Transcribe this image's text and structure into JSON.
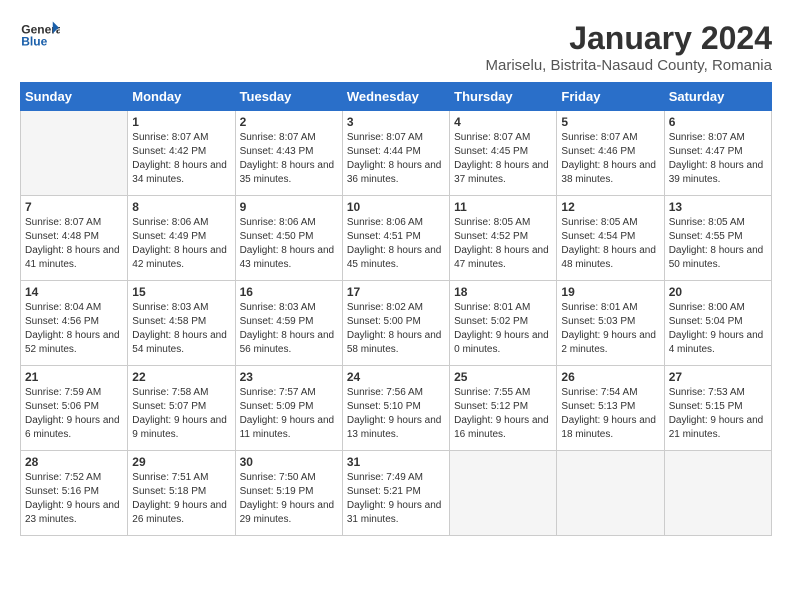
{
  "header": {
    "logo_general": "General",
    "logo_blue": "Blue",
    "title": "January 2024",
    "subtitle": "Mariselu, Bistrita-Nasaud County, Romania"
  },
  "days_of_week": [
    "Sunday",
    "Monday",
    "Tuesday",
    "Wednesday",
    "Thursday",
    "Friday",
    "Saturday"
  ],
  "weeks": [
    [
      {
        "day": "",
        "sunrise": "",
        "sunset": "",
        "daylight": "",
        "empty": true
      },
      {
        "day": "1",
        "sunrise": "Sunrise: 8:07 AM",
        "sunset": "Sunset: 4:42 PM",
        "daylight": "Daylight: 8 hours and 34 minutes."
      },
      {
        "day": "2",
        "sunrise": "Sunrise: 8:07 AM",
        "sunset": "Sunset: 4:43 PM",
        "daylight": "Daylight: 8 hours and 35 minutes."
      },
      {
        "day": "3",
        "sunrise": "Sunrise: 8:07 AM",
        "sunset": "Sunset: 4:44 PM",
        "daylight": "Daylight: 8 hours and 36 minutes."
      },
      {
        "day": "4",
        "sunrise": "Sunrise: 8:07 AM",
        "sunset": "Sunset: 4:45 PM",
        "daylight": "Daylight: 8 hours and 37 minutes."
      },
      {
        "day": "5",
        "sunrise": "Sunrise: 8:07 AM",
        "sunset": "Sunset: 4:46 PM",
        "daylight": "Daylight: 8 hours and 38 minutes."
      },
      {
        "day": "6",
        "sunrise": "Sunrise: 8:07 AM",
        "sunset": "Sunset: 4:47 PM",
        "daylight": "Daylight: 8 hours and 39 minutes."
      }
    ],
    [
      {
        "day": "7",
        "sunrise": "Sunrise: 8:07 AM",
        "sunset": "Sunset: 4:48 PM",
        "daylight": "Daylight: 8 hours and 41 minutes."
      },
      {
        "day": "8",
        "sunrise": "Sunrise: 8:06 AM",
        "sunset": "Sunset: 4:49 PM",
        "daylight": "Daylight: 8 hours and 42 minutes."
      },
      {
        "day": "9",
        "sunrise": "Sunrise: 8:06 AM",
        "sunset": "Sunset: 4:50 PM",
        "daylight": "Daylight: 8 hours and 43 minutes."
      },
      {
        "day": "10",
        "sunrise": "Sunrise: 8:06 AM",
        "sunset": "Sunset: 4:51 PM",
        "daylight": "Daylight: 8 hours and 45 minutes."
      },
      {
        "day": "11",
        "sunrise": "Sunrise: 8:05 AM",
        "sunset": "Sunset: 4:52 PM",
        "daylight": "Daylight: 8 hours and 47 minutes."
      },
      {
        "day": "12",
        "sunrise": "Sunrise: 8:05 AM",
        "sunset": "Sunset: 4:54 PM",
        "daylight": "Daylight: 8 hours and 48 minutes."
      },
      {
        "day": "13",
        "sunrise": "Sunrise: 8:05 AM",
        "sunset": "Sunset: 4:55 PM",
        "daylight": "Daylight: 8 hours and 50 minutes."
      }
    ],
    [
      {
        "day": "14",
        "sunrise": "Sunrise: 8:04 AM",
        "sunset": "Sunset: 4:56 PM",
        "daylight": "Daylight: 8 hours and 52 minutes."
      },
      {
        "day": "15",
        "sunrise": "Sunrise: 8:03 AM",
        "sunset": "Sunset: 4:58 PM",
        "daylight": "Daylight: 8 hours and 54 minutes."
      },
      {
        "day": "16",
        "sunrise": "Sunrise: 8:03 AM",
        "sunset": "Sunset: 4:59 PM",
        "daylight": "Daylight: 8 hours and 56 minutes."
      },
      {
        "day": "17",
        "sunrise": "Sunrise: 8:02 AM",
        "sunset": "Sunset: 5:00 PM",
        "daylight": "Daylight: 8 hours and 58 minutes."
      },
      {
        "day": "18",
        "sunrise": "Sunrise: 8:01 AM",
        "sunset": "Sunset: 5:02 PM",
        "daylight": "Daylight: 9 hours and 0 minutes."
      },
      {
        "day": "19",
        "sunrise": "Sunrise: 8:01 AM",
        "sunset": "Sunset: 5:03 PM",
        "daylight": "Daylight: 9 hours and 2 minutes."
      },
      {
        "day": "20",
        "sunrise": "Sunrise: 8:00 AM",
        "sunset": "Sunset: 5:04 PM",
        "daylight": "Daylight: 9 hours and 4 minutes."
      }
    ],
    [
      {
        "day": "21",
        "sunrise": "Sunrise: 7:59 AM",
        "sunset": "Sunset: 5:06 PM",
        "daylight": "Daylight: 9 hours and 6 minutes."
      },
      {
        "day": "22",
        "sunrise": "Sunrise: 7:58 AM",
        "sunset": "Sunset: 5:07 PM",
        "daylight": "Daylight: 9 hours and 9 minutes."
      },
      {
        "day": "23",
        "sunrise": "Sunrise: 7:57 AM",
        "sunset": "Sunset: 5:09 PM",
        "daylight": "Daylight: 9 hours and 11 minutes."
      },
      {
        "day": "24",
        "sunrise": "Sunrise: 7:56 AM",
        "sunset": "Sunset: 5:10 PM",
        "daylight": "Daylight: 9 hours and 13 minutes."
      },
      {
        "day": "25",
        "sunrise": "Sunrise: 7:55 AM",
        "sunset": "Sunset: 5:12 PM",
        "daylight": "Daylight: 9 hours and 16 minutes."
      },
      {
        "day": "26",
        "sunrise": "Sunrise: 7:54 AM",
        "sunset": "Sunset: 5:13 PM",
        "daylight": "Daylight: 9 hours and 18 minutes."
      },
      {
        "day": "27",
        "sunrise": "Sunrise: 7:53 AM",
        "sunset": "Sunset: 5:15 PM",
        "daylight": "Daylight: 9 hours and 21 minutes."
      }
    ],
    [
      {
        "day": "28",
        "sunrise": "Sunrise: 7:52 AM",
        "sunset": "Sunset: 5:16 PM",
        "daylight": "Daylight: 9 hours and 23 minutes."
      },
      {
        "day": "29",
        "sunrise": "Sunrise: 7:51 AM",
        "sunset": "Sunset: 5:18 PM",
        "daylight": "Daylight: 9 hours and 26 minutes."
      },
      {
        "day": "30",
        "sunrise": "Sunrise: 7:50 AM",
        "sunset": "Sunset: 5:19 PM",
        "daylight": "Daylight: 9 hours and 29 minutes."
      },
      {
        "day": "31",
        "sunrise": "Sunrise: 7:49 AM",
        "sunset": "Sunset: 5:21 PM",
        "daylight": "Daylight: 9 hours and 31 minutes."
      },
      {
        "day": "",
        "sunrise": "",
        "sunset": "",
        "daylight": "",
        "empty": true
      },
      {
        "day": "",
        "sunrise": "",
        "sunset": "",
        "daylight": "",
        "empty": true
      },
      {
        "day": "",
        "sunrise": "",
        "sunset": "",
        "daylight": "",
        "empty": true
      }
    ]
  ]
}
